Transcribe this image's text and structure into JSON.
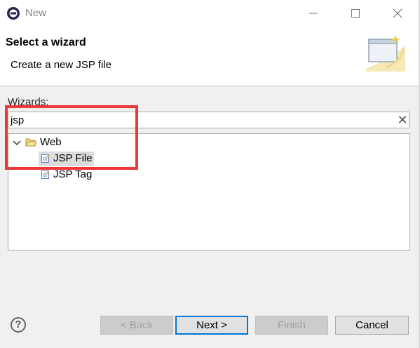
{
  "window": {
    "title": "New"
  },
  "banner": {
    "title": "Select a wizard",
    "description": "Create a new JSP file"
  },
  "wizards": {
    "label": "Wizards:",
    "filter_value": "jsp",
    "tree": {
      "folder_label": "Web",
      "items": [
        {
          "label": "JSP File",
          "selected": true
        },
        {
          "label": "JSP Tag",
          "selected": false
        }
      ]
    }
  },
  "buttons": {
    "back": "< Back",
    "next": "Next >",
    "finish": "Finish",
    "cancel": "Cancel"
  },
  "colors": {
    "highlight": "#ee3838",
    "default_button_border": "#0078d7"
  }
}
